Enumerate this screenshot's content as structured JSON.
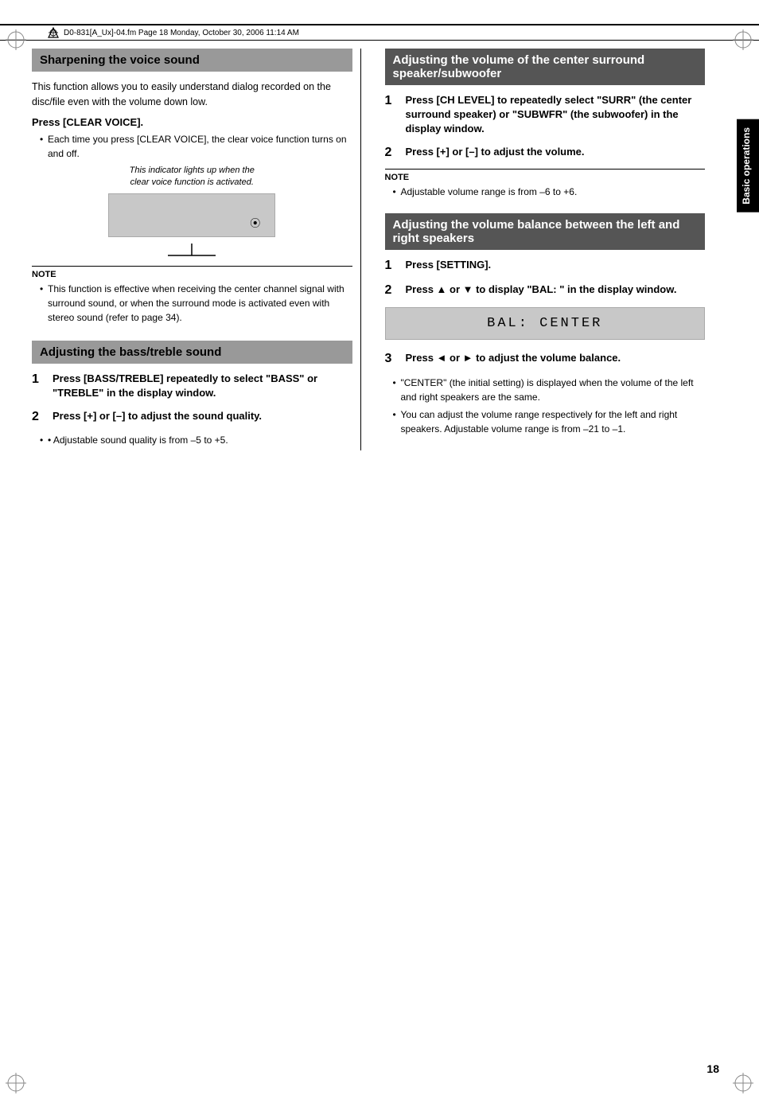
{
  "page": {
    "number": "18",
    "file_info": "D0-831[A_Ux]-04.fm  Page 18  Monday, October 30, 2006  11:14 AM"
  },
  "side_tab": {
    "label": "Basic operations"
  },
  "left_column": {
    "section1": {
      "title": "Sharpening the voice sound",
      "intro": "This function allows you to easily understand dialog recorded on the disc/file even with the volume down low.",
      "sub_heading": "Press [CLEAR VOICE].",
      "bullet1": "Each time you press [CLEAR VOICE], the clear voice function turns on and off.",
      "indicator_note1": "This indicator lights up when the",
      "indicator_note2": "clear voice function is activated.",
      "note_label": "NOTE",
      "note_bullet": "This function is effective when receiving the center channel signal with surround sound, or when the surround mode is activated even with stereo sound (refer to page 34)."
    },
    "section2": {
      "title": "Adjusting the bass/treble sound",
      "step1": {
        "number": "1",
        "text": "Press [BASS/TREBLE] repeatedly to select \"BASS\" or \"TREBLE\" in the display window."
      },
      "step2": {
        "number": "2",
        "text": "Press [+] or [–] to adjust the sound quality."
      },
      "note": "• Adjustable sound quality is from –5 to +5."
    }
  },
  "right_column": {
    "section1": {
      "title": "Adjusting the volume of the center surround speaker/subwoofer",
      "step1": {
        "number": "1",
        "text": "Press [CH LEVEL] to repeatedly select \"SURR\" (the center surround speaker) or \"SUBWFR\" (the subwoofer) in the display window."
      },
      "step2": {
        "number": "2",
        "text": "Press [+] or [–] to adjust the volume."
      },
      "note_label": "NOTE",
      "note_bullet": "Adjustable volume range is from –6 to +6."
    },
    "section2": {
      "title": "Adjusting the volume balance between the left and right speakers",
      "step1": {
        "number": "1",
        "text": "Press [SETTING]."
      },
      "step2": {
        "number": "2",
        "text": "Press ▲ or ▼ to display \"BAL: \" in the display window."
      },
      "display_text": "BAL: CENTER",
      "step3": {
        "number": "3",
        "text": "Press ◄ or ► to adjust the volume balance."
      },
      "bullet1": "\"CENTER\" (the initial setting) is displayed when the volume of the left and right speakers are the same.",
      "bullet2": "You can adjust the volume range respectively for the left and right speakers. Adjustable volume range is from –21 to –1."
    }
  }
}
